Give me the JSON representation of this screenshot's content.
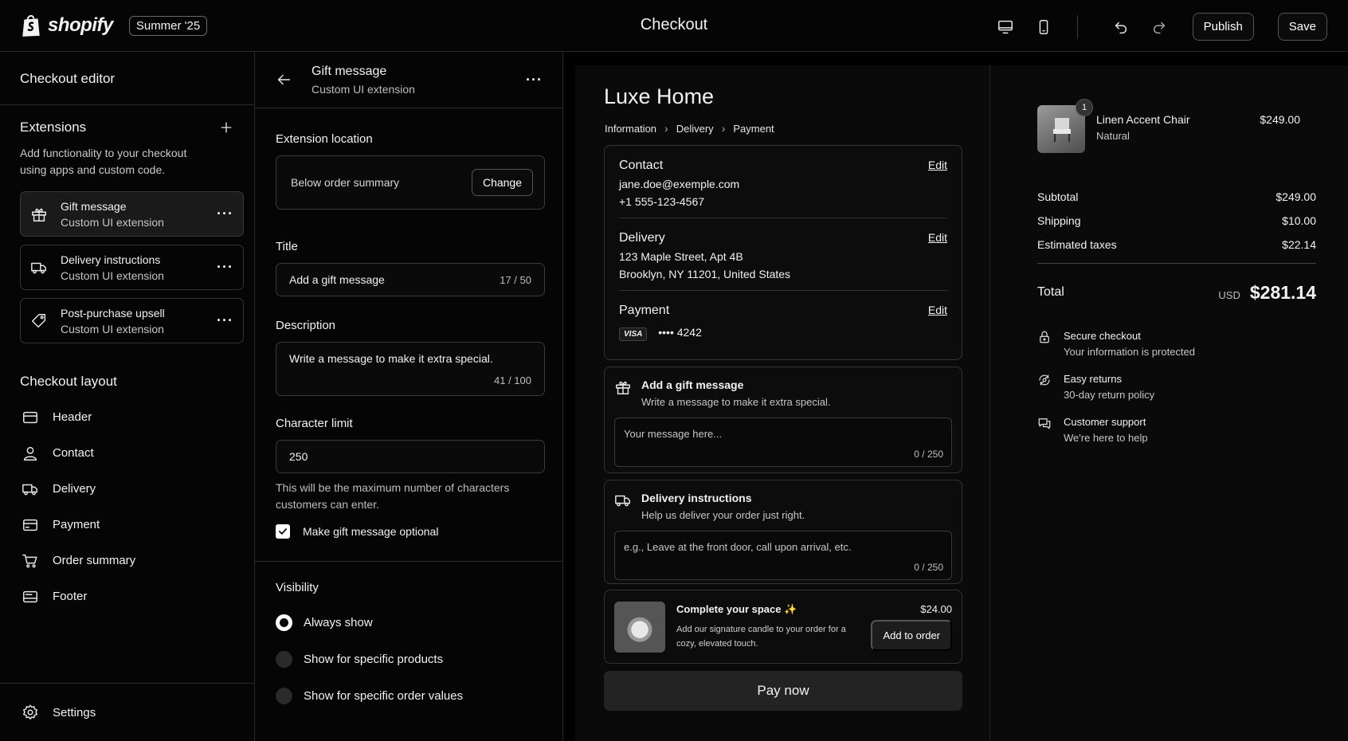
{
  "topbar": {
    "brand": "shopify",
    "release": "Summer '25",
    "title": "Checkout",
    "publish": "Publish",
    "save": "Save"
  },
  "left": {
    "header": "Checkout editor",
    "extensions_title": "Extensions",
    "extensions_desc": "Add functionality to your checkout using apps and custom code.",
    "extensions": [
      {
        "title": "Gift message",
        "sub": "Custom UI extension"
      },
      {
        "title": "Delivery instructions",
        "sub": "Custom UI extension"
      },
      {
        "title": "Post-purchase upsell",
        "sub": "Custom UI extension"
      }
    ],
    "layout_title": "Checkout layout",
    "layout": [
      "Header",
      "Contact",
      "Delivery",
      "Payment",
      "Order summary",
      "Footer"
    ],
    "settings": "Settings"
  },
  "mid": {
    "title": "Gift message",
    "sub": "Custom UI extension",
    "location_label": "Extension location",
    "location_value": "Below order summary",
    "change": "Change",
    "title_label": "Title",
    "title_value": "Add a gift message",
    "title_count": "17 / 50",
    "desc_label": "Description",
    "desc_value": "Write a message to make it extra special.",
    "desc_count": "41 / 100",
    "limit_label": "Character limit",
    "limit_value": "250",
    "limit_help": "This will be the maximum number of characters customers can enter.",
    "optional_label": "Make gift message optional",
    "visibility_label": "Visibility",
    "visibility_options": [
      "Always show",
      "Show for specific products",
      "Show for specific order values"
    ]
  },
  "preview": {
    "store": "Luxe Home",
    "breadcrumbs": [
      "Information",
      "Delivery",
      "Payment"
    ],
    "contact_title": "Contact",
    "contact_email": "jane.doe@exemple.com",
    "contact_phone": "+1 555-123-4567",
    "delivery_title": "Delivery",
    "delivery_line1": "123 Maple Street, Apt 4B",
    "delivery_line2": "Brooklyn, NY 11201, United States",
    "payment_title": "Payment",
    "card_brand": "VISA",
    "card_number": "•••• 4242",
    "edit": "Edit",
    "gift_title": "Add a gift message",
    "gift_sub": "Write a message to make it extra special.",
    "gift_placeholder": "Your message here...",
    "gift_count": "0 / 250",
    "deliv_title": "Delivery instructions",
    "deliv_sub": "Help us deliver your order just right.",
    "deliv_placeholder": "e.g., Leave at the front door, call upon arrival, etc.",
    "deliv_count": "0 / 250",
    "upsell_title": "Complete your space ✨",
    "upsell_desc": "Add our signature candle to your order for a cozy, elevated touch.",
    "upsell_price": "$24.00",
    "upsell_btn": "Add to order",
    "pay": "Pay now"
  },
  "order": {
    "product_name": "Linen Accent Chair",
    "product_variant": "Natural",
    "product_price": "$249.00",
    "qty": "1",
    "subtotal_label": "Subtotal",
    "subtotal": "$249.00",
    "shipping_label": "Shipping",
    "shipping": "$10.00",
    "taxes_label": "Estimated taxes",
    "taxes": "$22.14",
    "total_label": "Total",
    "currency": "USD",
    "total": "$281.14",
    "trust": [
      {
        "title": "Secure checkout",
        "sub": "Your information is protected"
      },
      {
        "title": "Easy returns",
        "sub": "30-day return policy"
      },
      {
        "title": "Customer support",
        "sub": "We're here to help"
      }
    ]
  }
}
